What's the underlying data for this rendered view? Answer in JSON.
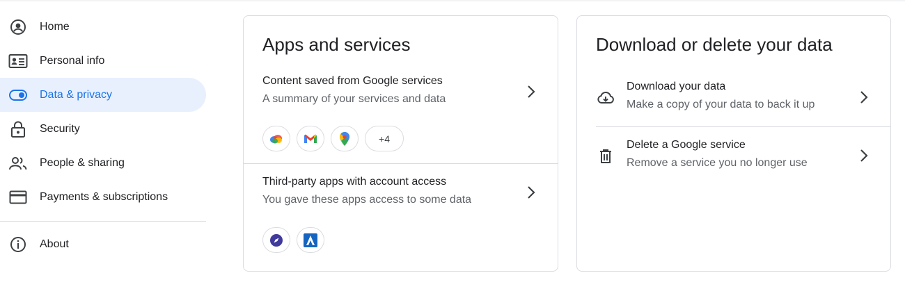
{
  "sidebar": {
    "items": [
      {
        "label": "Home",
        "icon": "account-circle-icon"
      },
      {
        "label": "Personal info",
        "icon": "id-card-icon"
      },
      {
        "label": "Data & privacy",
        "icon": "toggle-icon",
        "active": true
      },
      {
        "label": "Security",
        "icon": "lock-icon"
      },
      {
        "label": "People & sharing",
        "icon": "people-icon"
      },
      {
        "label": "Payments & subscriptions",
        "icon": "credit-card-icon"
      }
    ],
    "about": {
      "label": "About",
      "icon": "info-icon"
    }
  },
  "apps_card": {
    "title": "Apps and services",
    "content_saved": {
      "title": "Content saved from Google services",
      "subtitle": "A summary of your services and data",
      "chips": [
        "cloud-icon",
        "gmail-icon",
        "maps-pin-icon"
      ],
      "more_label": "+4"
    },
    "third_party": {
      "title": "Third-party apps with account access",
      "subtitle": "You gave these apps access to some data",
      "chips": [
        "compass-app-icon",
        "arrow-app-icon"
      ]
    }
  },
  "download_card": {
    "title": "Download or delete your data",
    "download": {
      "title": "Download your data",
      "subtitle": "Make a copy of your data to back it up",
      "icon": "cloud-download-icon"
    },
    "delete": {
      "title": "Delete a Google service",
      "subtitle": "Remove a service you no longer use",
      "icon": "trash-icon"
    }
  },
  "colors": {
    "accent": "#1a73e8",
    "active_bg": "#e8f0fe",
    "border": "#dadce0",
    "text": "#202124",
    "muted": "#5f6368"
  }
}
